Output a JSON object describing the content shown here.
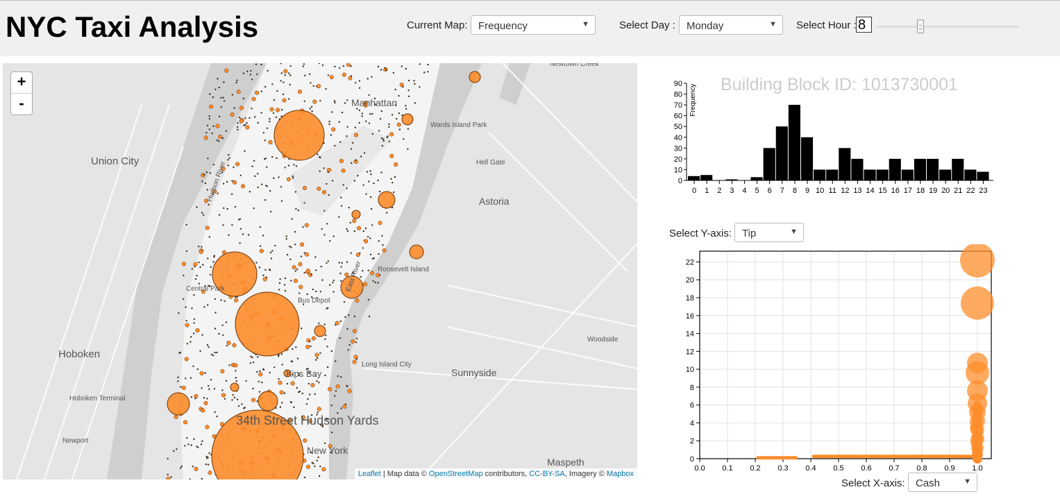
{
  "header": {
    "title": "NYC Taxi Analysis",
    "current_map_label": "Current Map:",
    "current_map_value": "Frequency",
    "select_day_label": "Select Day :",
    "select_day_value": "Monday",
    "select_hour_label": "Select Hour :",
    "hour_value": "8",
    "hour_slider_fraction": 0.33
  },
  "map": {
    "zoom_in": "+",
    "zoom_out": "-",
    "labels": [
      "Manhattan",
      "Union City",
      "Hoboken",
      "Astoria",
      "Sunnyside",
      "Maspeth",
      "Hoboken Terminal",
      "Newport",
      "Hudson River",
      "East River",
      "Roosevelt Island",
      "Long Island City",
      "Woodside",
      "Kips Bay",
      "Hell Gate",
      "Wards Island Park",
      "Newtown Creek",
      "Bus Depot",
      "Central Park",
      "34th Street Hudson Yards",
      "New York",
      "City"
    ],
    "attribution": {
      "leaflet": "Leaflet",
      "sep1": " | Map data © ",
      "osm": "OpenStreetMap",
      "contrib": " contributors, ",
      "license": "CC-BY-SA",
      "imagery": ", Imagery © ",
      "mapbox": "Mapbox"
    },
    "accent_color": "#fd8d2c"
  },
  "histogram": {
    "title": "Building Block ID: 1013730001"
  },
  "scatter": {
    "y_axis_label": "Select Y-axis:",
    "y_axis_value": "Tip",
    "x_axis_label": "Select X-axis:",
    "x_axis_value": "Cash"
  },
  "chart_data": [
    {
      "type": "bar",
      "title": "",
      "xlabel": "",
      "ylabel": "Frequency",
      "categories": [
        "0",
        "1",
        "2",
        "3",
        "4",
        "5",
        "6",
        "7",
        "8",
        "9",
        "10",
        "11",
        "12",
        "13",
        "14",
        "15",
        "16",
        "17",
        "18",
        "19",
        "20",
        "21",
        "22",
        "23"
      ],
      "values": [
        4,
        5,
        0,
        1,
        0,
        3,
        30,
        50,
        70,
        40,
        10,
        10,
        30,
        20,
        10,
        10,
        20,
        10,
        20,
        20,
        10,
        20,
        10,
        8
      ],
      "ylim": [
        0,
        90
      ],
      "yticks": [
        0,
        10,
        20,
        30,
        40,
        50,
        60,
        70,
        80,
        90
      ],
      "color": "#000000"
    },
    {
      "type": "scatter",
      "title": "",
      "xlabel": "",
      "ylabel": "",
      "xlim": [
        0,
        1.05
      ],
      "ylim": [
        0,
        23.2
      ],
      "xticks": [
        "0.0",
        "0.1",
        "0.2",
        "0.3",
        "0.4",
        "0.5",
        "0.6",
        "0.7",
        "0.8",
        "0.9",
        "1.0"
      ],
      "yticks": [
        0,
        2,
        4,
        6,
        8,
        10,
        12,
        14,
        16,
        18,
        20,
        22
      ],
      "grid": true,
      "color": "#fd8d2c",
      "points": [
        {
          "x": 1.0,
          "y": 22.2,
          "r": 25
        },
        {
          "x": 1.0,
          "y": 17.4,
          "r": 24
        },
        {
          "x": 1.0,
          "y": 10.7,
          "r": 15
        },
        {
          "x": 1.0,
          "y": 9.6,
          "r": 17
        },
        {
          "x": 1.0,
          "y": 7.6,
          "r": 15
        },
        {
          "x": 1.0,
          "y": 6.2,
          "r": 14
        },
        {
          "x": 1.0,
          "y": 5.2,
          "r": 12
        },
        {
          "x": 1.0,
          "y": 4.2,
          "r": 11
        },
        {
          "x": 1.0,
          "y": 3.2,
          "r": 10
        },
        {
          "x": 1.0,
          "y": 2.2,
          "r": 10
        },
        {
          "x": 1.0,
          "y": 1.2,
          "r": 9
        },
        {
          "x": 1.0,
          "y": 0.5,
          "r": 8
        },
        {
          "x": 0.995,
          "y": 3.5,
          "r": 9
        },
        {
          "x": 0.995,
          "y": 1.8,
          "r": 8
        }
      ],
      "bands": [
        {
          "x_from": 0.21,
          "x_to": 0.35,
          "y": 0.1
        },
        {
          "x_from": 0.41,
          "x_to": 0.99,
          "y": 0.25
        }
      ]
    }
  ]
}
